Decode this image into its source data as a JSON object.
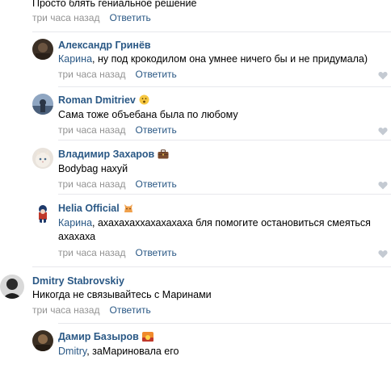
{
  "comments": [
    {
      "author": "",
      "text": "Просто блять гениальное решение",
      "time": "три часа назад",
      "reply": "Ответить"
    },
    {
      "author": "Александр Гринёв",
      "mention": "Карина",
      "text": ", ну под крокодилом она умнее ничего бы и не придумала)",
      "time": "три часа назад",
      "reply": "Ответить"
    },
    {
      "author": "Roman Dmitriev",
      "text": "Сама тоже объебана была по любому",
      "time": "три часа назад",
      "reply": "Ответить"
    },
    {
      "author": "Владимир Захаров",
      "text": "Bodybag нахуй",
      "time": "три часа назад",
      "reply": "Ответить"
    },
    {
      "author": "Helia Official",
      "mention": "Карина",
      "text": ", ахахахаххахахахаха бля помогите остановиться смеяться ахахаха",
      "time": "три часа назад",
      "reply": "Ответить"
    },
    {
      "author": "Dmitry Stabrovskiy",
      "text": "Никогда не связывайтесь с Маринами",
      "time": "три часа назад",
      "reply": "Ответить"
    },
    {
      "author": "Дамир Базыров",
      "mention": "Dmitry",
      "text": ", заМариновала его",
      "time": "",
      "reply": ""
    }
  ],
  "colors": {
    "link": "#2a5885",
    "meta": "#939393",
    "separator": "#e7e8ec"
  }
}
